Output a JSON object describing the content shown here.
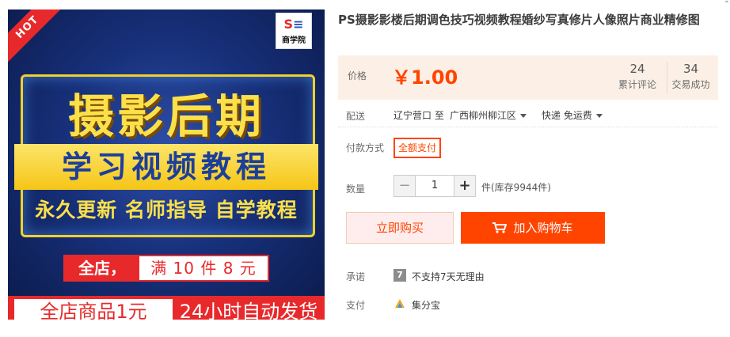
{
  "product_image": {
    "hot_badge": "HOT",
    "logo_mark": "S",
    "logo_name": "商学院",
    "headline": "摄影后期",
    "subheadline": "学习视频教程",
    "tagline": "永久更新 名师指导 自学教程",
    "promo_left": "全店，",
    "promo_right": "满 10 件 8 元",
    "strip_left": "全店商品1元",
    "strip_right": "24小时自动发货"
  },
  "product": {
    "title": "PS摄影影楼后期调色技巧视频教程婚纱写真修片人像照片商业精修图",
    "corner_mark": "⌃"
  },
  "price": {
    "label": "价格",
    "value": "￥1.00",
    "reviews_count": "24",
    "reviews_label": "累计评论",
    "sales_count": "34",
    "sales_label": "交易成功"
  },
  "shipping": {
    "label": "配送",
    "origin": "辽宁营口 至",
    "destination": "广西柳州柳江区",
    "method": "快递 免运费"
  },
  "payment": {
    "label": "付款方式",
    "option": "全额支付"
  },
  "quantity": {
    "label": "数量",
    "minus": "−",
    "value": "1",
    "plus": "+",
    "stock": "件(库存9944件)"
  },
  "actions": {
    "buy_now": "立即购买",
    "add_to_cart": "加入购物车"
  },
  "service": {
    "promise_label": "承诺",
    "promise_icon": "7",
    "promise_text": "不支持7天无理由",
    "pay_label": "支付",
    "pay_text": "集分宝"
  },
  "colors": {
    "accent": "#ff4400",
    "price_bg": "#fcf0e6",
    "image_red": "#e8292c",
    "image_yellow": "#fbe04a"
  }
}
